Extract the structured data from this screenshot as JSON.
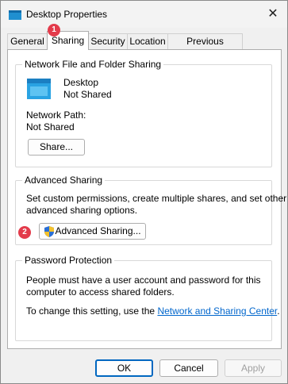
{
  "window": {
    "title": "Desktop Properties",
    "close_glyph": "✕"
  },
  "tabs": [
    {
      "label": "General"
    },
    {
      "label": "Sharing"
    },
    {
      "label": "Security"
    },
    {
      "label": "Location"
    },
    {
      "label": "Previous Versions"
    }
  ],
  "annotations": {
    "badge1": "1",
    "badge2": "2"
  },
  "network_sharing": {
    "group_title": "Network File and Folder Sharing",
    "folder_name": "Desktop",
    "status": "Not Shared",
    "path_label": "Network Path:",
    "path_value": "Not Shared",
    "share_button": "Share..."
  },
  "advanced_sharing": {
    "group_title": "Advanced Sharing",
    "description_line1": "Set custom permissions, create multiple shares, and set other",
    "description_line2": "advanced sharing options.",
    "button": "Advanced Sharing..."
  },
  "password_protection": {
    "group_title": "Password Protection",
    "line1": "People must have a user account and password for this",
    "line2": "computer to access shared folders.",
    "change_prefix": "To change this setting, use the ",
    "link_text": "Network and Sharing Center",
    "change_suffix": "."
  },
  "buttons": {
    "ok": "OK",
    "cancel": "Cancel",
    "apply": "Apply"
  },
  "colors": {
    "accent": "#0067c0",
    "badge": "#e33b4b",
    "link": "#0066cc",
    "folder": "#29a3e3"
  }
}
